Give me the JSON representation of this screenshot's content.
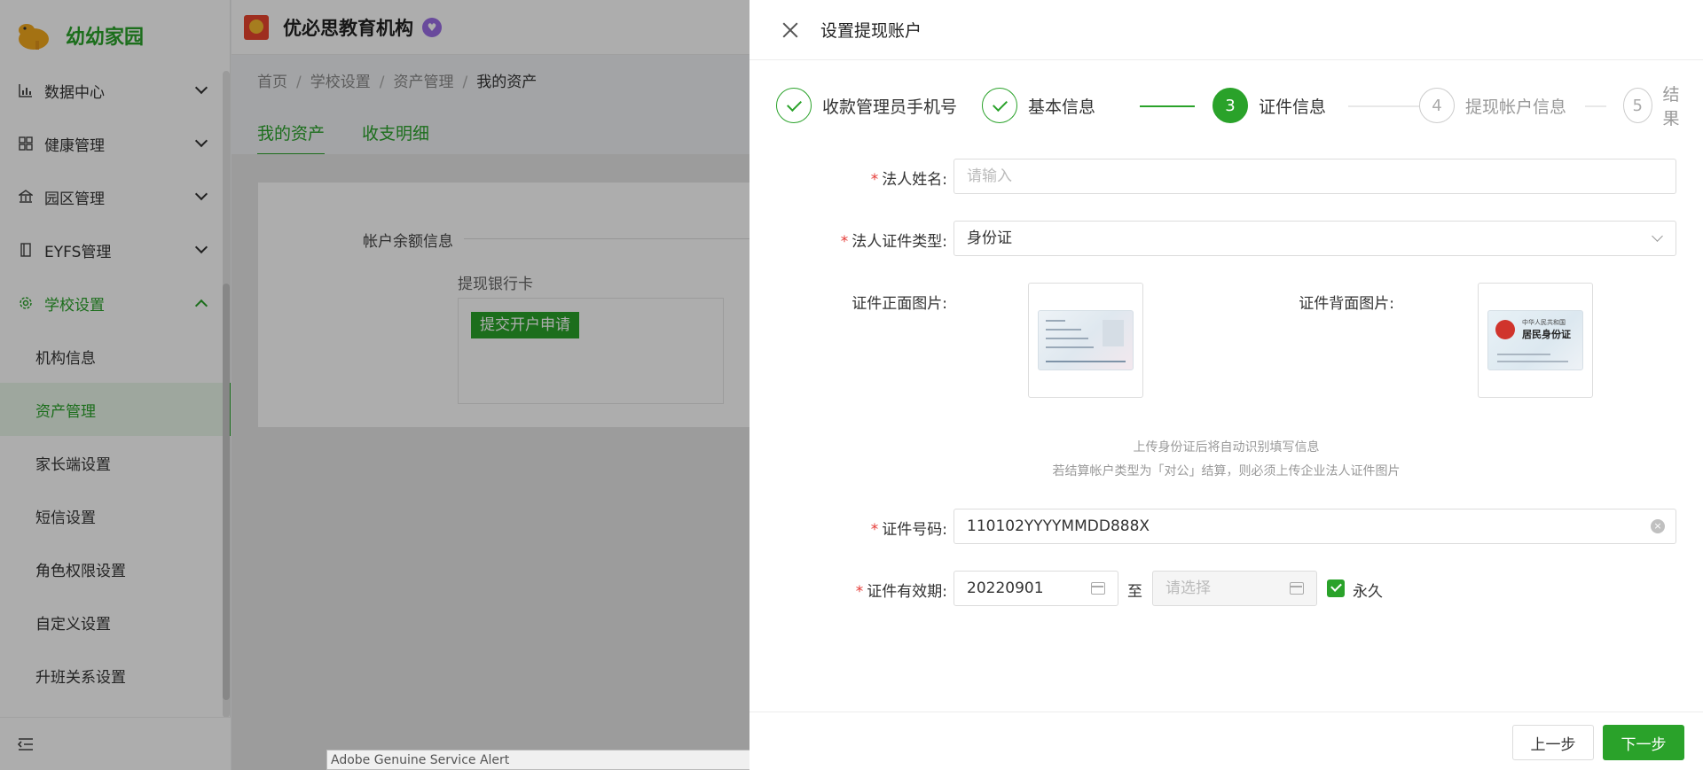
{
  "sidebar": {
    "brand": "幼幼家园",
    "menu": [
      {
        "label": "数据中心",
        "icon": "bar-chart-icon"
      },
      {
        "label": "健康管理",
        "icon": "grid-icon"
      },
      {
        "label": "园区管理",
        "icon": "building-icon"
      },
      {
        "label": "EYFS管理",
        "icon": "book-icon"
      },
      {
        "label": "学校设置",
        "icon": "gear-icon"
      }
    ],
    "submenu": [
      "机构信息",
      "资产管理",
      "家长端设置",
      "短信设置",
      "角色权限设置",
      "自定义设置",
      "升班关系设置"
    ],
    "selected_sub": "资产管理"
  },
  "topbar": {
    "org_name": "优必思教育机构"
  },
  "breadcrumb": {
    "items": [
      "首页",
      "学校设置",
      "资产管理",
      "我的资产"
    ]
  },
  "tabs": [
    "我的资产",
    "收支明细"
  ],
  "card": {
    "title": "帐户余额信息",
    "subtitle": "提现银行卡",
    "apply_button": "提交开户申请"
  },
  "alert": {
    "text": "Adobe Genuine Service Alert"
  },
  "drawer": {
    "title": "设置提现账户",
    "steps": [
      {
        "label": "收款管理员手机号",
        "status": "finish",
        "num": "1"
      },
      {
        "label": "基本信息",
        "status": "finish",
        "num": "2"
      },
      {
        "label": "证件信息",
        "status": "process",
        "num": "3"
      },
      {
        "label": "提现帐户信息",
        "status": "wait",
        "num": "4"
      },
      {
        "label": "结果",
        "status": "wait",
        "num": "5"
      }
    ],
    "form": {
      "legal_name_label": "法人姓名:",
      "legal_name_placeholder": "请输入",
      "id_type_label": "法人证件类型:",
      "id_type_value": "身份证",
      "front_label": "证件正面图片:",
      "back_label": "证件背面图片:",
      "hint_1": "上传身份证后将自动识别填写信息",
      "hint_2": "若结算帐户类型为「对公」结算，则必须上传企业法人证件图片",
      "id_no_label": "证件号码:",
      "id_no_value": "110102YYYYMMDD888X",
      "validity_label": "证件有效期:",
      "start_date": "20220901",
      "to_text": "至",
      "end_placeholder": "请选择",
      "forever_label": "永久",
      "forever_checked": true,
      "id_back_title_small": "中华人民共和国",
      "id_back_title": "居民身份证"
    },
    "prev_button": "上一步",
    "next_button": "下一步"
  },
  "colors": {
    "primary": "#2aa22a",
    "required": "#e53935"
  }
}
